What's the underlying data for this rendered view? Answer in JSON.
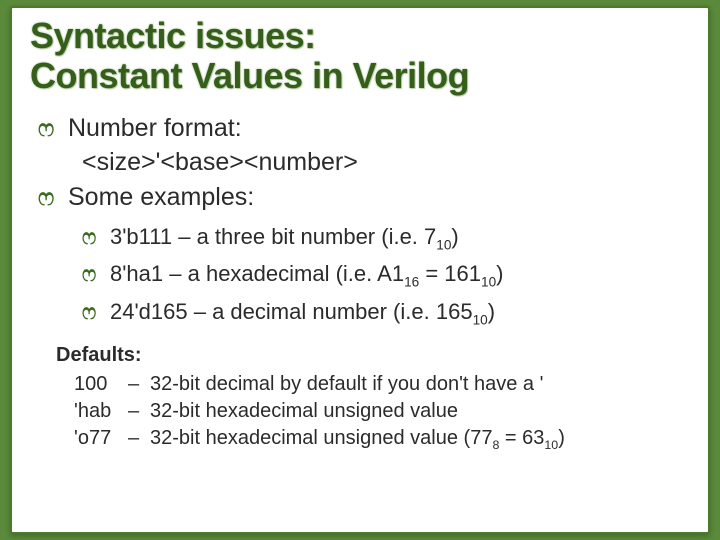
{
  "title_line1": "Syntactic issues:",
  "title_line2": "Constant Values in Verilog",
  "bullet_glyph": "ෆ",
  "p1_a": "Number format:",
  "p1_b": "<size>'<base><number>",
  "p2": "Some examples:",
  "ex1_code": "3'b111",
  "ex1_desc_a": " – a three bit number (i.e. 7",
  "ex1_sub": "10",
  "ex1_desc_b": ")",
  "ex2_code": "8'ha1",
  "ex2_desc_a": " – a hexadecimal (i.e. A1",
  "ex2_sub1": "16",
  "ex2_desc_b": " = 161",
  "ex2_sub2": "10",
  "ex2_desc_c": ")",
  "ex3_code": "24'd165",
  "ex3_desc_a": " – a decimal number (i.e. 165",
  "ex3_sub": "10",
  "ex3_desc_b": ")",
  "defaults_head": "Defaults:",
  "d1_key": "100",
  "d1_dash": "–",
  "d1_text": "32-bit decimal by default if you don't have a '",
  "d2_key": "'hab",
  "d2_dash": "–",
  "d2_text": "32-bit hexadecimal unsigned value",
  "d3_key": "'o77",
  "d3_dash": "–",
  "d3_text_a": "32-bit hexadecimal unsigned value  (77",
  "d3_sub1": "8",
  "d3_text_b": " = 63",
  "d3_sub2": "10",
  "d3_text_c": ")"
}
